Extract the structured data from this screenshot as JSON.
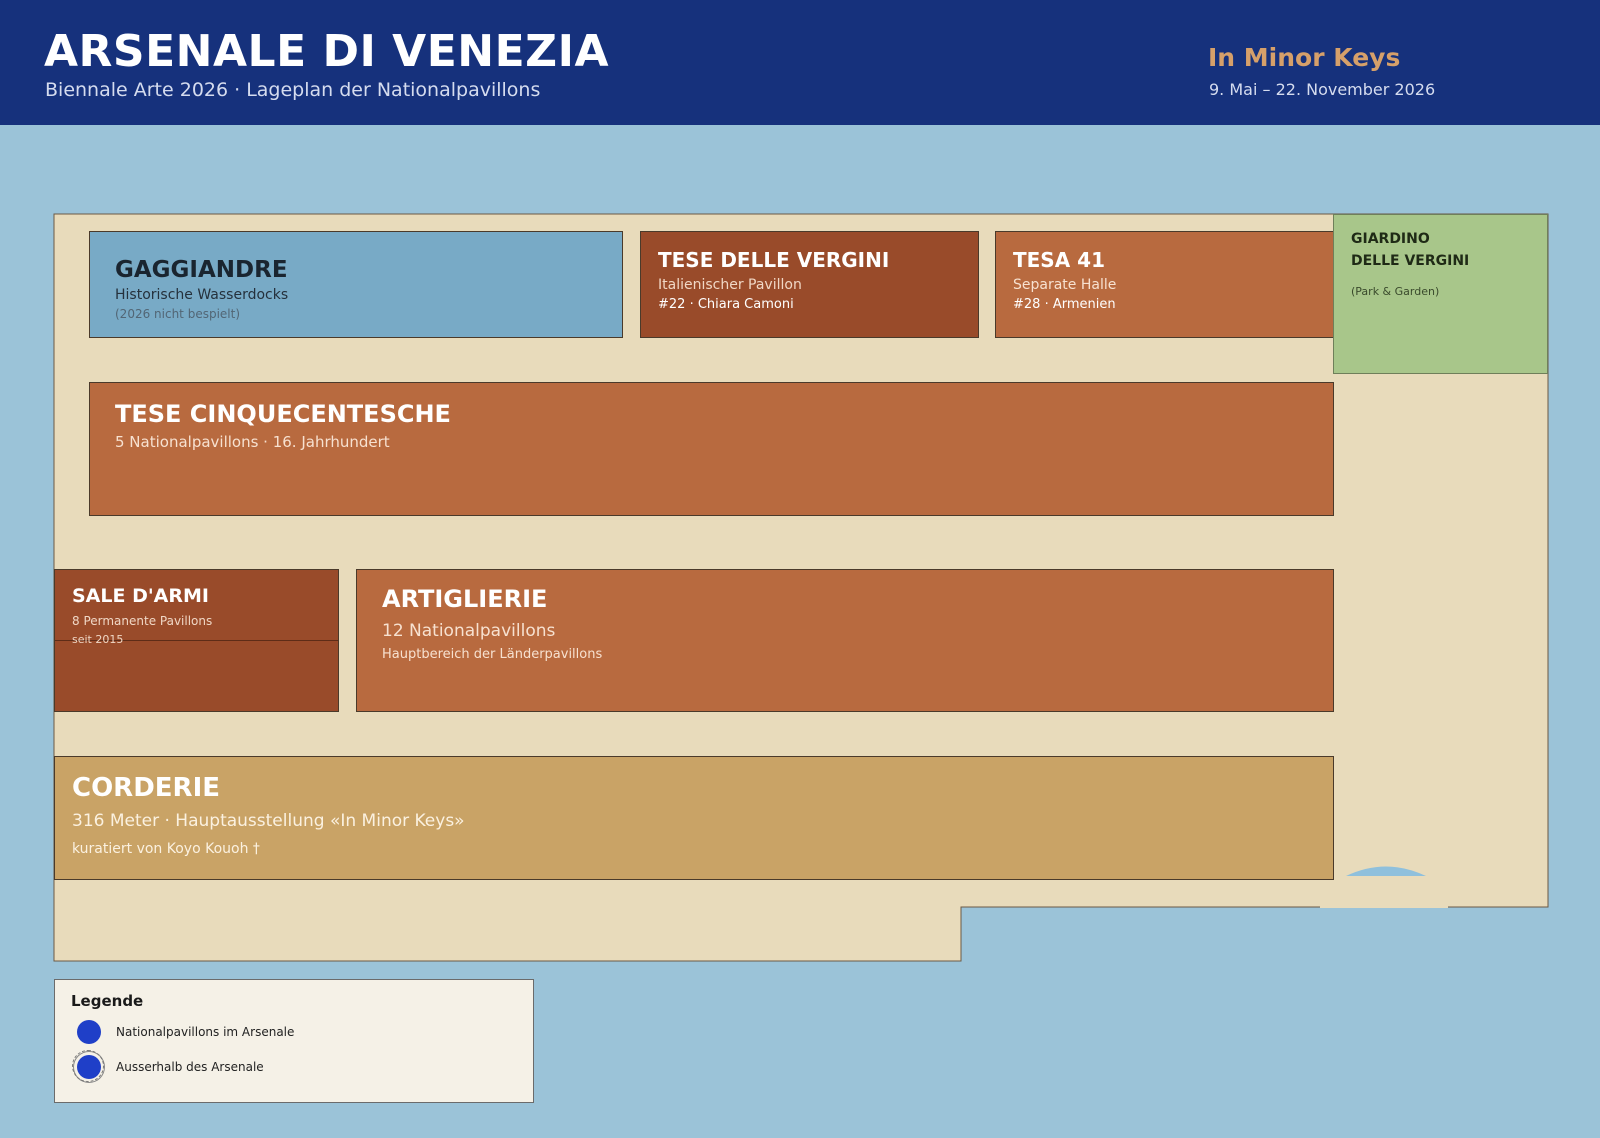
{
  "header": {
    "title": "ARSENALE DI VENEZIA",
    "subtitle": "Biennale Arte 2026 · Lageplan der Nationalpavillons",
    "theme": "In Minor Keys",
    "dates": "9. Mai – 22. November 2026"
  },
  "buildings": {
    "gaggiandre": {
      "name": "GAGGIANDRE",
      "line1": "Historische Wasserdocks",
      "line2": "(2026 nicht bespielt)"
    },
    "tese_delle_vergini": {
      "name": "TESE DELLE VERGINI",
      "line1": "Italienischer Pavillon",
      "line2": "#22 · Chiara Camoni"
    },
    "tesa_41": {
      "name": "TESA 41",
      "line1": "Separate Halle",
      "line2": "#28 · Armenien"
    },
    "giardino": {
      "name_line1": "GIARDINO",
      "name_line2": "DELLE VERGINI",
      "line1": "(Park & Garden)"
    },
    "tese_cinquecentesche": {
      "name": "TESE CINQUECENTESCHE",
      "line1": "5 Nationalpavillons · 16. Jahrhundert"
    },
    "sale_darmi": {
      "name": "SALE D'ARMI",
      "line1": "8 Permanente Pavillons",
      "line2": "seit 2015"
    },
    "artiglierie": {
      "name": "ARTIGLIERIE",
      "line1": "12 Nationalpavillons",
      "line2": "Hauptbereich der Länderpavillons"
    },
    "corderie": {
      "name": "CORDERIE",
      "line1": "316 Meter · Hauptausstellung «In Minor Keys»",
      "line2": "kuratiert von Koyo Kouoh †"
    }
  },
  "legend": {
    "title": "Legende",
    "items": [
      {
        "label": "Nationalpavillons im Arsenale",
        "type": "inside"
      },
      {
        "label": "Ausserhalb des Arsenale",
        "type": "outside"
      }
    ]
  },
  "colors": {
    "header_bg": "#16317c",
    "water": "#9bc3d8",
    "ground": "#e8dbbb",
    "dock": "#78aac6",
    "hall_dark": "#994b2a",
    "hall": "#b86a3f",
    "corderie": "#c9a366",
    "garden": "#a8c68a",
    "pavilion_marker": "#1f3fc8"
  }
}
